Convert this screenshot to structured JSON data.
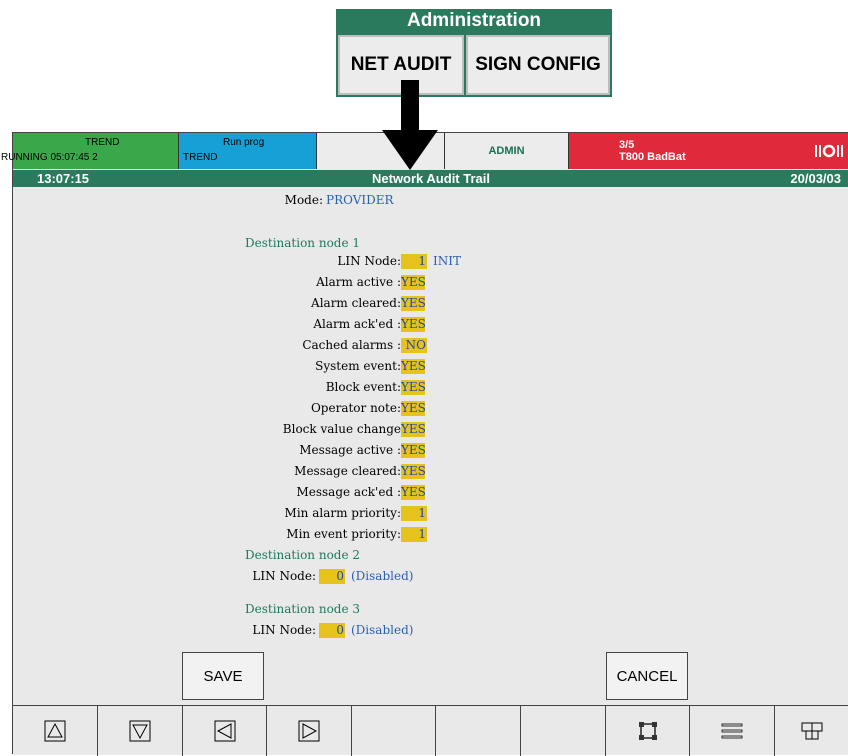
{
  "admin_menu": {
    "title": "Administration",
    "net_audit_label": "NET AUDIT",
    "sign_config_label": "SIGN CONFIG"
  },
  "status_bar": {
    "trend_title": "TREND",
    "trend_status": "RUNNING  05:07:45      2",
    "run_prog_title": "Run prog",
    "run_prog_sub": "TREND",
    "user": "ADMIN",
    "alarm_count": "3/5",
    "alarm_text": "T800 BadBat"
  },
  "title_bar": {
    "time": "13:07:15",
    "title": "Network Audit Trail",
    "date": "20/03/03"
  },
  "form": {
    "mode_label": "Mode:",
    "mode_value": "PROVIDER",
    "node1": {
      "heading": "Destination node 1",
      "lin_node_label": "LIN Node:",
      "lin_node_value": "1",
      "lin_node_status": "INIT",
      "fields": [
        {
          "label": "Alarm active :",
          "value": "YES"
        },
        {
          "label": "Alarm cleared:",
          "value": "YES"
        },
        {
          "label": "Alarm ack'ed :",
          "value": "YES"
        },
        {
          "label": "Cached alarms :",
          "value": "NO"
        },
        {
          "label": "System event:",
          "value": "YES"
        },
        {
          "label": "Block event:",
          "value": "YES"
        },
        {
          "label": "Operator note:",
          "value": "YES"
        },
        {
          "label": "Block value change",
          "value": "YES"
        },
        {
          "label": "Message active :",
          "value": "YES"
        },
        {
          "label": "Message cleared:",
          "value": "YES"
        },
        {
          "label": "Message ack'ed :",
          "value": "YES"
        },
        {
          "label": "Min alarm priority:",
          "value": "1"
        },
        {
          "label": "Min event priority:",
          "value": "1"
        }
      ]
    },
    "node2": {
      "heading": "Destination node 2",
      "lin_node_label": "LIN Node:",
      "lin_node_value": "0",
      "lin_node_status": "(Disabled)"
    },
    "node3": {
      "heading": "Destination node 3",
      "lin_node_label": "LIN Node:",
      "lin_node_value": "0",
      "lin_node_status": "(Disabled)"
    },
    "save_label": "SAVE",
    "cancel_label": "CANCEL"
  },
  "toolbar": {
    "icons": [
      "up-arrow-icon",
      "down-arrow-icon",
      "left-arrow-icon",
      "right-arrow-icon",
      "blank",
      "blank",
      "blank",
      "recycle-icon",
      "menu-lines-icon",
      "grid-icon"
    ]
  },
  "colors": {
    "title_green": "#2a7a5e",
    "status_green": "#3aa84a",
    "status_blue": "#17a0d6",
    "alarm_red": "#e02a3a",
    "value_yellow": "#e6c21d"
  }
}
